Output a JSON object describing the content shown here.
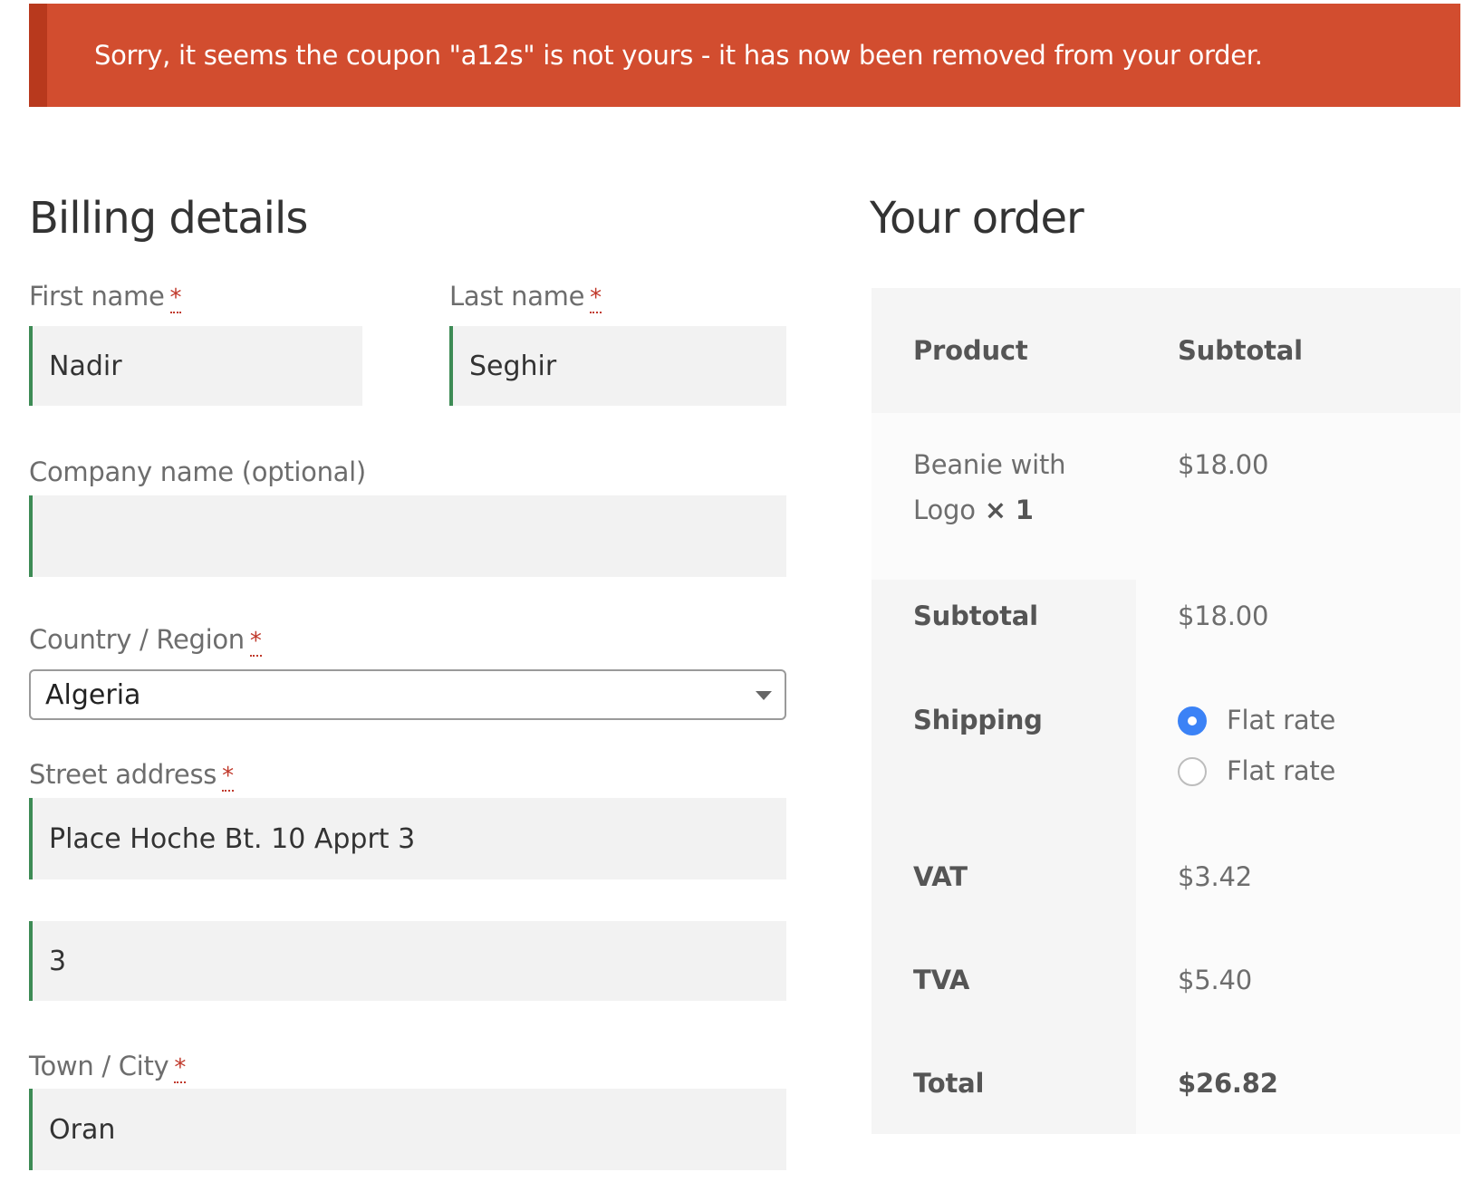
{
  "notice": {
    "message": "Sorry, it seems the coupon \"a12s\" is not yours - it has now been removed from your order."
  },
  "billing": {
    "title": "Billing details",
    "first_name": {
      "label": "First name",
      "required": "*",
      "value": "Nadir"
    },
    "last_name": {
      "label": "Last name",
      "required": "*",
      "value": "Seghir"
    },
    "company": {
      "label": "Company name (optional)",
      "value": ""
    },
    "country": {
      "label": "Country / Region",
      "required": "*",
      "value": "Algeria"
    },
    "street": {
      "label": "Street address",
      "required": "*",
      "line1": "Place Hoche Bt. 10 Apprt 3",
      "line2": "3"
    },
    "city": {
      "label": "Town / City",
      "required": "*",
      "value": "Oran"
    }
  },
  "order": {
    "title": "Your order",
    "columns": {
      "product": "Product",
      "subtotal": "Subtotal"
    },
    "item": {
      "name_line1": "Beanie with",
      "name_line2": "Logo",
      "qty": "× 1",
      "price": "$18.00"
    },
    "subtotal": {
      "label": "Subtotal",
      "value": "$18.00"
    },
    "shipping": {
      "label": "Shipping",
      "options": [
        {
          "label": "Flat rate",
          "selected": true
        },
        {
          "label": "Flat rate",
          "selected": false
        }
      ]
    },
    "vat": {
      "label": "VAT",
      "value": "$3.42"
    },
    "tva": {
      "label": "TVA",
      "value": "$5.40"
    },
    "total": {
      "label": "Total",
      "value": "$26.82"
    }
  },
  "colors": {
    "notice_bg": "#d24d2f",
    "field_accent": "#3d8b55",
    "radio_selected": "#3b82f6"
  }
}
